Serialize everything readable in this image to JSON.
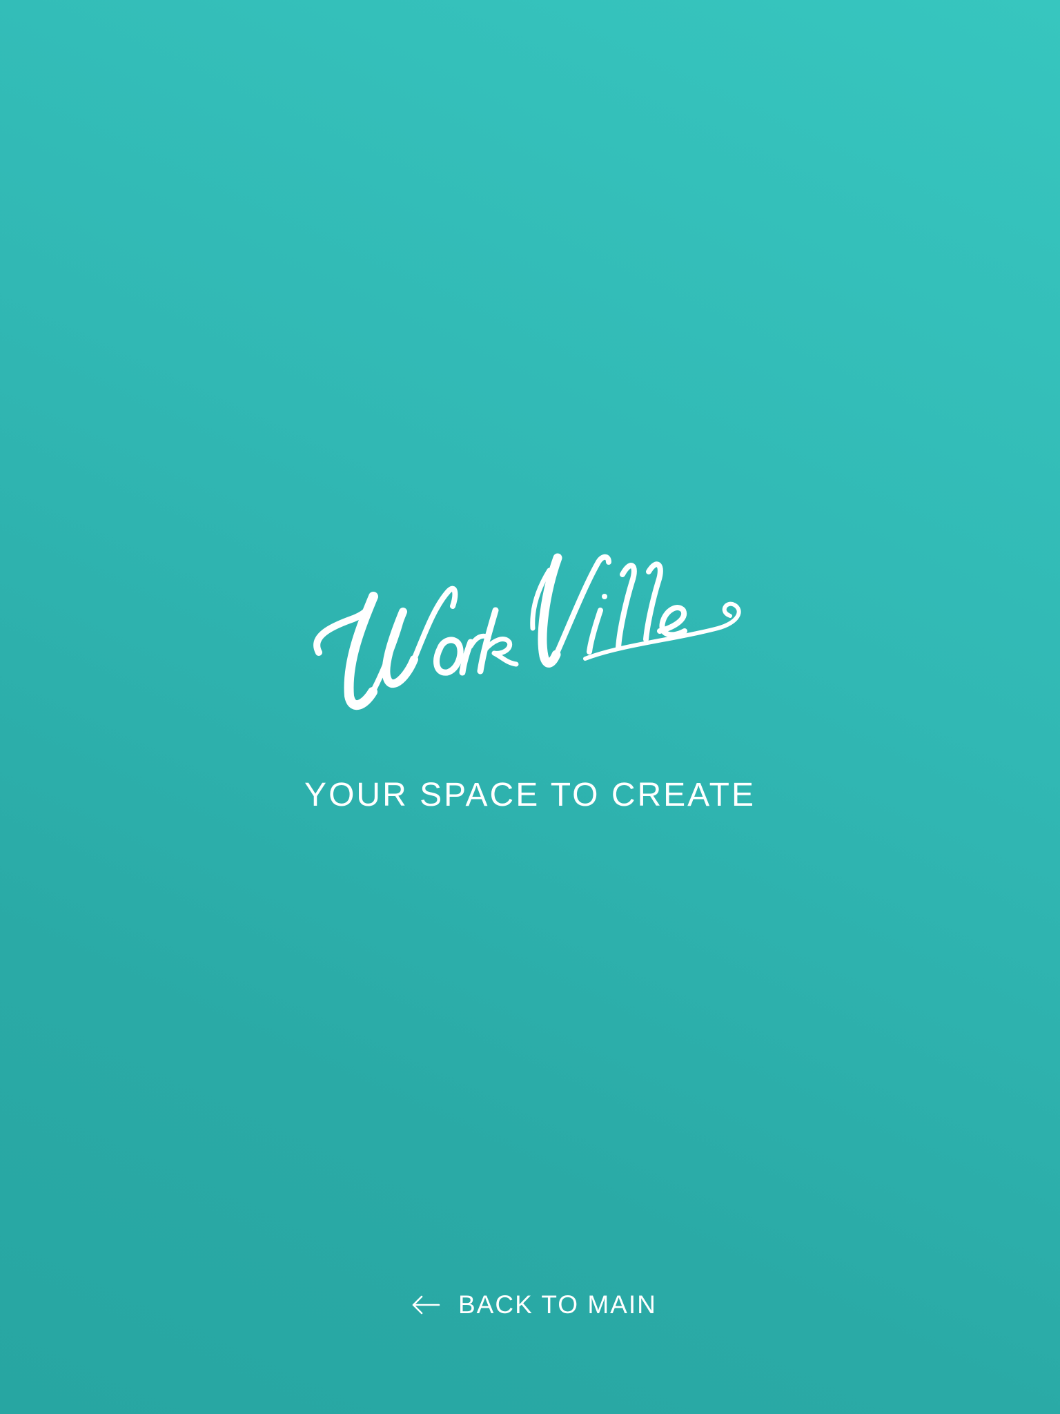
{
  "app": {
    "logo_text": "WorkVille",
    "tagline": "YOUR SPACE TO CREATE",
    "background_colors": [
      "#37c6bf",
      "#27a6a2"
    ],
    "text_color": "#ffffff"
  },
  "navigation": {
    "back_label": "BACK TO MAIN",
    "back_icon": "arrow-left-icon"
  }
}
